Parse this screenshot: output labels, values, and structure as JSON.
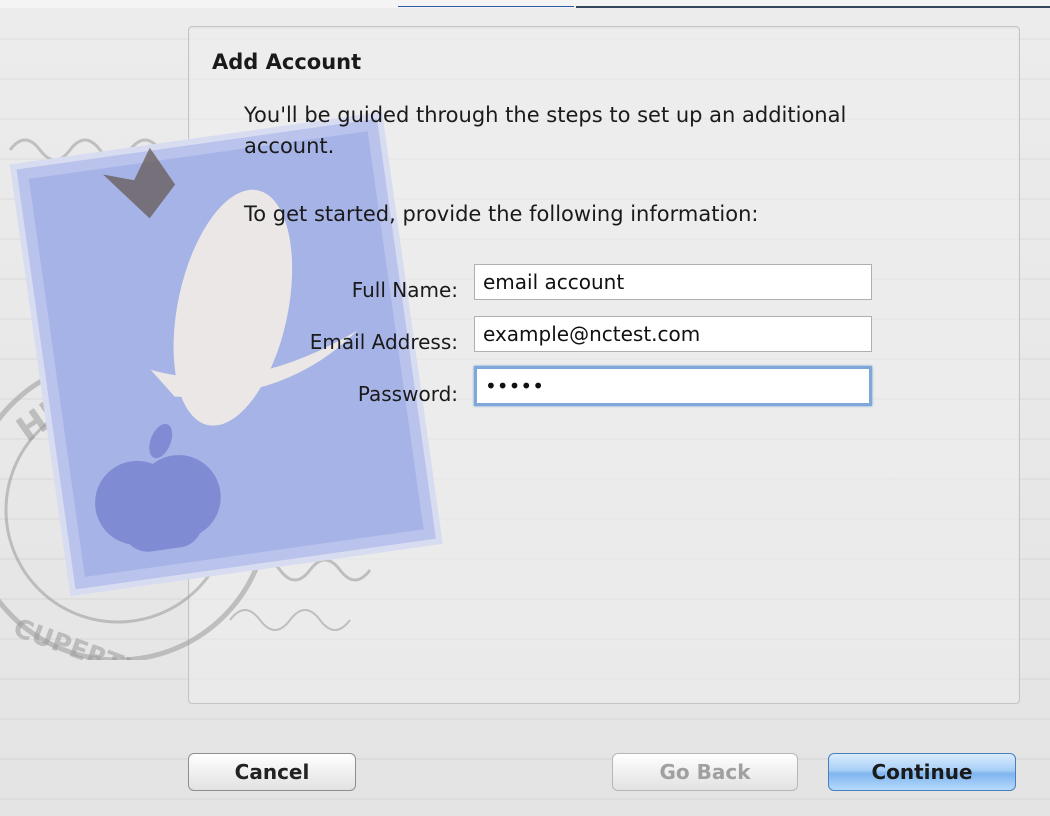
{
  "dialog": {
    "title": "Add Account",
    "intro": "You'll be guided through the steps to set up an additional account.",
    "prompt": "To get started, provide the following information:"
  },
  "fields": {
    "full_name": {
      "label": "Full Name:",
      "value": "email account"
    },
    "email": {
      "label": "Email Address:",
      "value": "example@nctest.com"
    },
    "password": {
      "label": "Password:",
      "value": "•••••"
    }
  },
  "buttons": {
    "cancel": "Cancel",
    "go_back": "Go Back",
    "continue": "Continue"
  },
  "colors": {
    "primary_button": "#7fb5ee",
    "focus_ring": "#7fa7d9",
    "stamp": "#8f9ed6"
  },
  "icons": {
    "stamp_art": "mail-stamp-icon"
  }
}
